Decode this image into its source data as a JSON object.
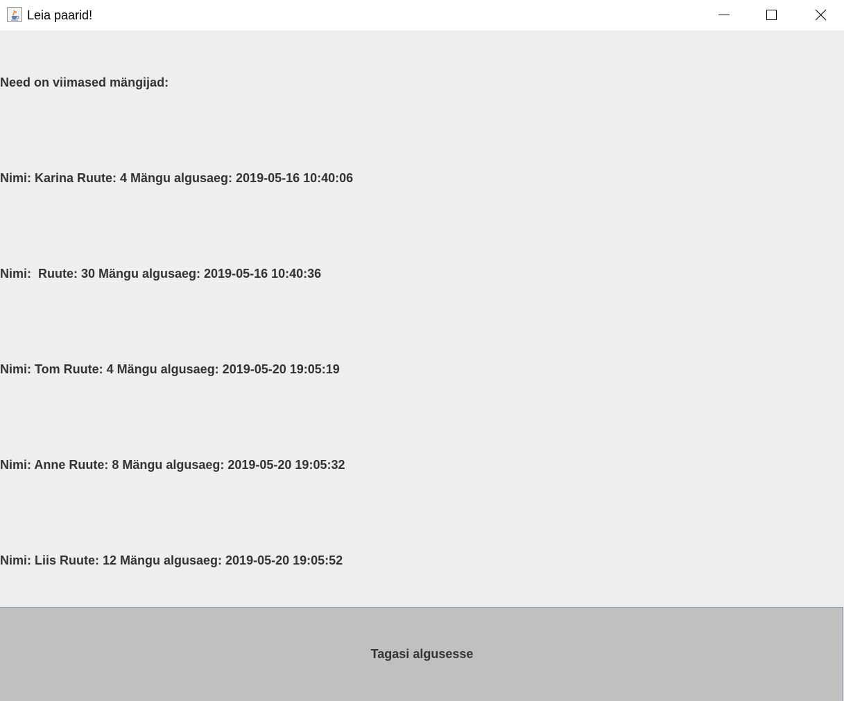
{
  "window": {
    "title": "Leia paarid!",
    "icon": "java-cup-icon"
  },
  "controls": {
    "minimize_icon": "minimize-icon",
    "maximize_icon": "maximize-icon",
    "close_icon": "close-icon"
  },
  "content": {
    "heading": "Need on viimased mängijad:",
    "players": [
      "Nimi: Karina Ruute: 4 Mängu algusaeg: 2019-05-16 10:40:06",
      "Nimi:  Ruute: 30 Mängu algusaeg: 2019-05-16 10:40:36",
      "Nimi: Tom Ruute: 4 Mängu algusaeg: 2019-05-20 19:05:19",
      "Nimi: Anne Ruute: 8 Mängu algusaeg: 2019-05-20 19:05:32",
      "Nimi: Liis Ruute: 12 Mängu algusaeg: 2019-05-20 19:05:52"
    ]
  },
  "footer": {
    "back_label": "Tagasi algusesse"
  },
  "colors": {
    "background": "#eeeeee",
    "titlebar": "#ffffff",
    "text": "#333333",
    "button": "#c0c0c0",
    "button_border": "#7a8a99"
  }
}
